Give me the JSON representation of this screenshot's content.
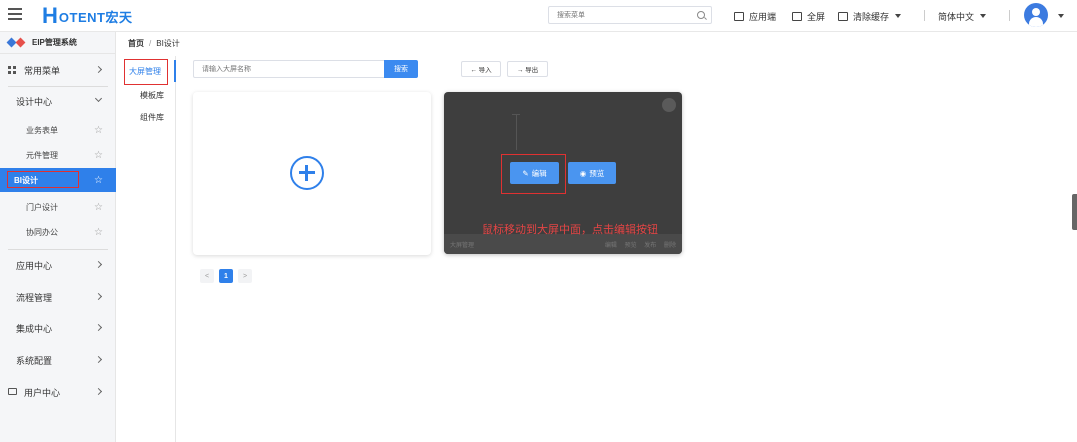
{
  "header": {
    "logo_h": "H",
    "logo_text": "OTENT宏天",
    "search_placeholder": "搜索菜单",
    "app_label": "应用端",
    "fullscreen_label": "全屏",
    "clear_cache_label": "清除缓存",
    "language_label": "简体中文"
  },
  "sidebar": {
    "system_title": "EIP管理系统",
    "items": [
      {
        "label": "常用菜单"
      },
      {
        "label": "设计中心"
      },
      {
        "label": "业务表单"
      },
      {
        "label": "元件管理"
      },
      {
        "label": "BI设计"
      },
      {
        "label": "门户设计"
      },
      {
        "label": "协同办公"
      },
      {
        "label": "应用中心"
      },
      {
        "label": "流程管理"
      },
      {
        "label": "集成中心"
      },
      {
        "label": "系统配置"
      },
      {
        "label": "用户中心"
      }
    ]
  },
  "breadcrumb": {
    "home": "首页",
    "separator": "/",
    "current": "BI设计"
  },
  "subnav": {
    "items": [
      {
        "label": "大屏管理"
      },
      {
        "label": "模板库"
      },
      {
        "label": "组件库"
      }
    ]
  },
  "toolbar": {
    "search_placeholder": "请输入大屏名称",
    "search_button": "搜索",
    "import_button": "← 导入",
    "export_button": "→ 导出"
  },
  "card": {
    "edit_button": "编辑",
    "preview_button": "预览",
    "annotation": "鼠标移动到大屏中面，点击编辑按钮",
    "footer_name": "大屏管理",
    "footer_actions": [
      "编辑",
      "预览",
      "发布",
      "删除"
    ]
  },
  "pagination": {
    "prev": "<",
    "current": "1",
    "next": ">"
  },
  "colors": {
    "primary": "#2f80ea",
    "highlight_red": "#e03131"
  }
}
